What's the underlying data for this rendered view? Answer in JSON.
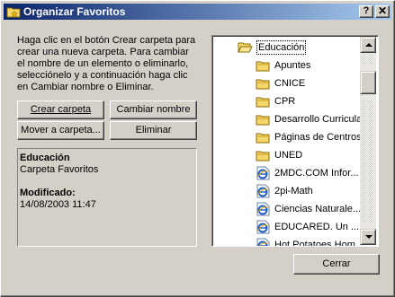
{
  "window": {
    "title": "Organizar Favoritos",
    "help_label": "?",
    "close_label": "✕"
  },
  "description": "Haga clic en el botón Crear carpeta para crear una nueva carpeta. Para cambiar el nombre de un elemento o eliminarlo, selecciónelo y a continuación haga clic en Cambiar nombre o Eliminar.",
  "buttons": {
    "create_folder": "Crear carpeta",
    "rename": "Cambiar nombre",
    "move_to_folder": "Mover a carpeta...",
    "delete": "Eliminar",
    "close": "Cerrar"
  },
  "info": {
    "name": "Educación",
    "type": "Carpeta Favoritos",
    "modified_label": "Modificado:",
    "modified_value": "14/08/2003 11:47"
  },
  "tree": {
    "root": {
      "label": "Educación",
      "icon": "folder-open-icon"
    },
    "items": [
      {
        "label": "Apuntes",
        "icon": "folder-icon"
      },
      {
        "label": "CNICE",
        "icon": "folder-icon"
      },
      {
        "label": "CPR",
        "icon": "folder-icon"
      },
      {
        "label": "Desarrollo Curricular",
        "icon": "folder-icon"
      },
      {
        "label": "Páginas de Centros",
        "icon": "folder-icon"
      },
      {
        "label": "UNED",
        "icon": "folder-icon"
      },
      {
        "label": "2MDC.COM Infor...",
        "icon": "ie-link-icon"
      },
      {
        "label": "2pi-Math",
        "icon": "ie-link-icon"
      },
      {
        "label": "Ciencias Naturale...",
        "icon": "ie-link-icon"
      },
      {
        "label": "EDUCARED. Un ...",
        "icon": "ie-link-icon"
      },
      {
        "label": "Hot Potatoes Hom...",
        "icon": "ie-link-icon"
      }
    ]
  },
  "colors": {
    "title_start": "#0a246a",
    "title_end": "#a6caf0",
    "face": "#d4d0c8",
    "folder": "#f5d66a"
  }
}
